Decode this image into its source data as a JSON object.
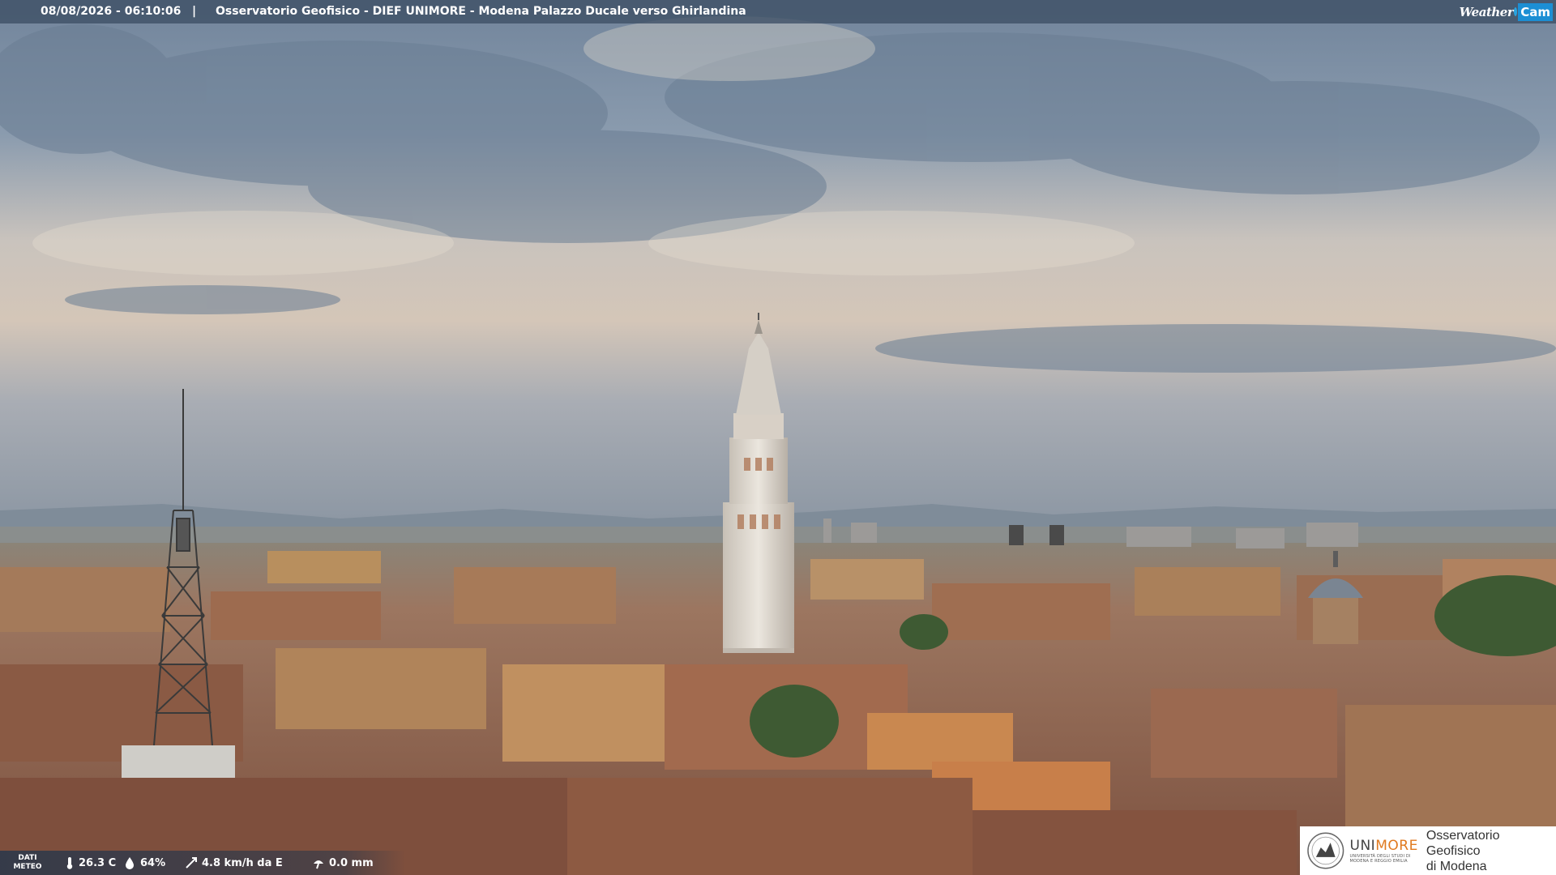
{
  "header": {
    "datetime": "08/08/2026 - 06:10:06",
    "separator": "|",
    "title": "Osservatorio Geofisico - DIEF UNIMORE - Modena Palazzo Ducale verso Ghirlandina"
  },
  "brand": {
    "weather_text": "Weather",
    "cam_text": "Cam"
  },
  "weather": {
    "label_line1": "DATI",
    "label_line2": "METEO",
    "temperature": "26.3 C",
    "humidity": "64%",
    "wind": "4.8 km/h da E",
    "rain": "0.0 mm",
    "icons": [
      "thermometer-icon",
      "humidity-drop-icon",
      "wind-icon",
      "rain-gauge-icon"
    ]
  },
  "logo": {
    "university_name_part1": "UNI",
    "university_name_part2": "MORE",
    "university_subtitle_line1": "UNIVERSITÀ DEGLI STUDI DI",
    "university_subtitle_line2": "MODENA E REGGIO EMILIA",
    "observatory_line1": "Osservatorio Geofisico",
    "observatory_line2": "di Modena"
  },
  "colors": {
    "sky_top": "#7d8ea3",
    "sky_horizon": "#d8c8b8",
    "roofs": "#9a6a4e",
    "tower": "#d9d4cc",
    "brand_blue": "#1c8fd4",
    "unimore_orange": "#e07a20"
  }
}
